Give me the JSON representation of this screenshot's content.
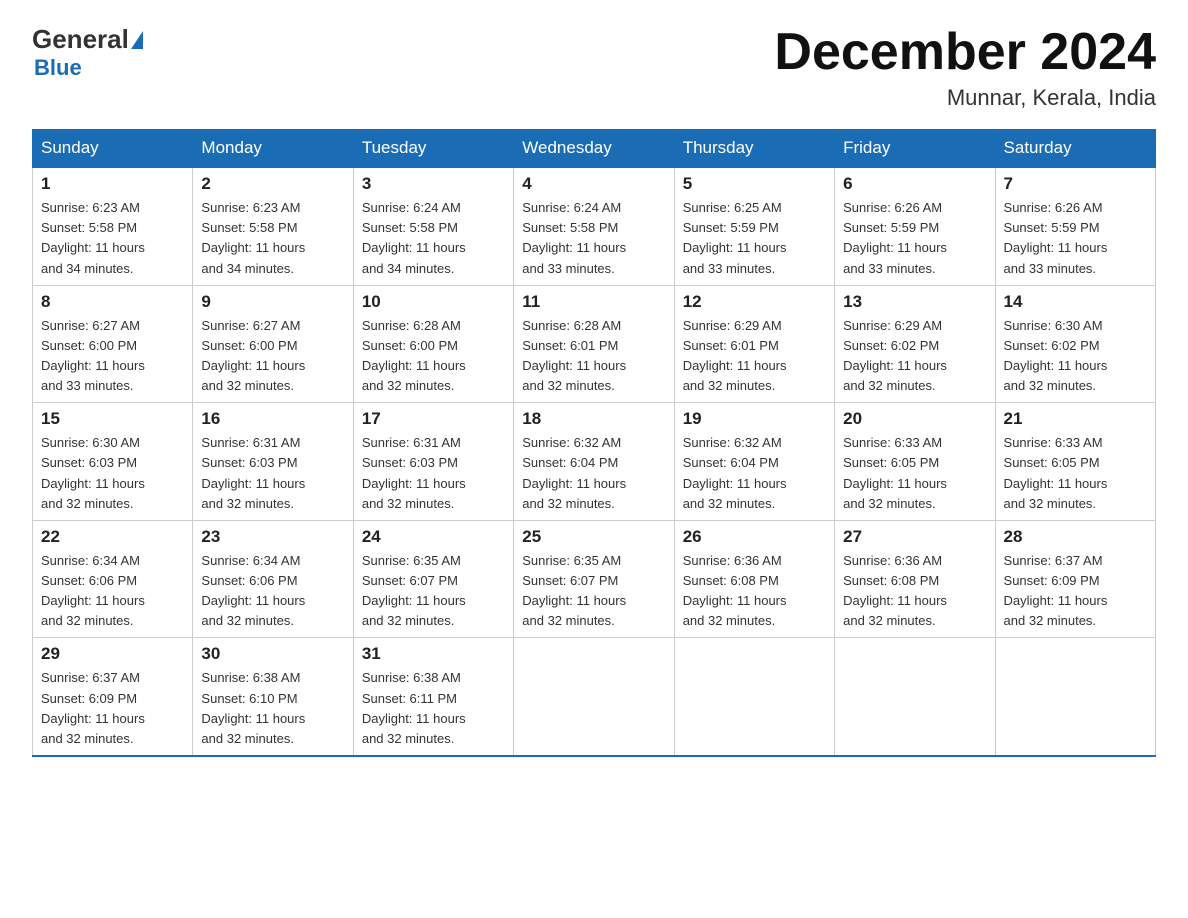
{
  "header": {
    "logo_general": "General",
    "logo_blue": "Blue",
    "month_title": "December 2024",
    "location": "Munnar, Kerala, India"
  },
  "columns": [
    "Sunday",
    "Monday",
    "Tuesday",
    "Wednesday",
    "Thursday",
    "Friday",
    "Saturday"
  ],
  "weeks": [
    [
      {
        "day": "1",
        "sunrise": "6:23 AM",
        "sunset": "5:58 PM",
        "daylight": "11 hours and 34 minutes."
      },
      {
        "day": "2",
        "sunrise": "6:23 AM",
        "sunset": "5:58 PM",
        "daylight": "11 hours and 34 minutes."
      },
      {
        "day": "3",
        "sunrise": "6:24 AM",
        "sunset": "5:58 PM",
        "daylight": "11 hours and 34 minutes."
      },
      {
        "day": "4",
        "sunrise": "6:24 AM",
        "sunset": "5:58 PM",
        "daylight": "11 hours and 33 minutes."
      },
      {
        "day": "5",
        "sunrise": "6:25 AM",
        "sunset": "5:59 PM",
        "daylight": "11 hours and 33 minutes."
      },
      {
        "day": "6",
        "sunrise": "6:26 AM",
        "sunset": "5:59 PM",
        "daylight": "11 hours and 33 minutes."
      },
      {
        "day": "7",
        "sunrise": "6:26 AM",
        "sunset": "5:59 PM",
        "daylight": "11 hours and 33 minutes."
      }
    ],
    [
      {
        "day": "8",
        "sunrise": "6:27 AM",
        "sunset": "6:00 PM",
        "daylight": "11 hours and 33 minutes."
      },
      {
        "day": "9",
        "sunrise": "6:27 AM",
        "sunset": "6:00 PM",
        "daylight": "11 hours and 32 minutes."
      },
      {
        "day": "10",
        "sunrise": "6:28 AM",
        "sunset": "6:00 PM",
        "daylight": "11 hours and 32 minutes."
      },
      {
        "day": "11",
        "sunrise": "6:28 AM",
        "sunset": "6:01 PM",
        "daylight": "11 hours and 32 minutes."
      },
      {
        "day": "12",
        "sunrise": "6:29 AM",
        "sunset": "6:01 PM",
        "daylight": "11 hours and 32 minutes."
      },
      {
        "day": "13",
        "sunrise": "6:29 AM",
        "sunset": "6:02 PM",
        "daylight": "11 hours and 32 minutes."
      },
      {
        "day": "14",
        "sunrise": "6:30 AM",
        "sunset": "6:02 PM",
        "daylight": "11 hours and 32 minutes."
      }
    ],
    [
      {
        "day": "15",
        "sunrise": "6:30 AM",
        "sunset": "6:03 PM",
        "daylight": "11 hours and 32 minutes."
      },
      {
        "day": "16",
        "sunrise": "6:31 AM",
        "sunset": "6:03 PM",
        "daylight": "11 hours and 32 minutes."
      },
      {
        "day": "17",
        "sunrise": "6:31 AM",
        "sunset": "6:03 PM",
        "daylight": "11 hours and 32 minutes."
      },
      {
        "day": "18",
        "sunrise": "6:32 AM",
        "sunset": "6:04 PM",
        "daylight": "11 hours and 32 minutes."
      },
      {
        "day": "19",
        "sunrise": "6:32 AM",
        "sunset": "6:04 PM",
        "daylight": "11 hours and 32 minutes."
      },
      {
        "day": "20",
        "sunrise": "6:33 AM",
        "sunset": "6:05 PM",
        "daylight": "11 hours and 32 minutes."
      },
      {
        "day": "21",
        "sunrise": "6:33 AM",
        "sunset": "6:05 PM",
        "daylight": "11 hours and 32 minutes."
      }
    ],
    [
      {
        "day": "22",
        "sunrise": "6:34 AM",
        "sunset": "6:06 PM",
        "daylight": "11 hours and 32 minutes."
      },
      {
        "day": "23",
        "sunrise": "6:34 AM",
        "sunset": "6:06 PM",
        "daylight": "11 hours and 32 minutes."
      },
      {
        "day": "24",
        "sunrise": "6:35 AM",
        "sunset": "6:07 PM",
        "daylight": "11 hours and 32 minutes."
      },
      {
        "day": "25",
        "sunrise": "6:35 AM",
        "sunset": "6:07 PM",
        "daylight": "11 hours and 32 minutes."
      },
      {
        "day": "26",
        "sunrise": "6:36 AM",
        "sunset": "6:08 PM",
        "daylight": "11 hours and 32 minutes."
      },
      {
        "day": "27",
        "sunrise": "6:36 AM",
        "sunset": "6:08 PM",
        "daylight": "11 hours and 32 minutes."
      },
      {
        "day": "28",
        "sunrise": "6:37 AM",
        "sunset": "6:09 PM",
        "daylight": "11 hours and 32 minutes."
      }
    ],
    [
      {
        "day": "29",
        "sunrise": "6:37 AM",
        "sunset": "6:09 PM",
        "daylight": "11 hours and 32 minutes."
      },
      {
        "day": "30",
        "sunrise": "6:38 AM",
        "sunset": "6:10 PM",
        "daylight": "11 hours and 32 minutes."
      },
      {
        "day": "31",
        "sunrise": "6:38 AM",
        "sunset": "6:11 PM",
        "daylight": "11 hours and 32 minutes."
      },
      null,
      null,
      null,
      null
    ]
  ],
  "labels": {
    "sunrise": "Sunrise:",
    "sunset": "Sunset:",
    "daylight": "Daylight:"
  }
}
